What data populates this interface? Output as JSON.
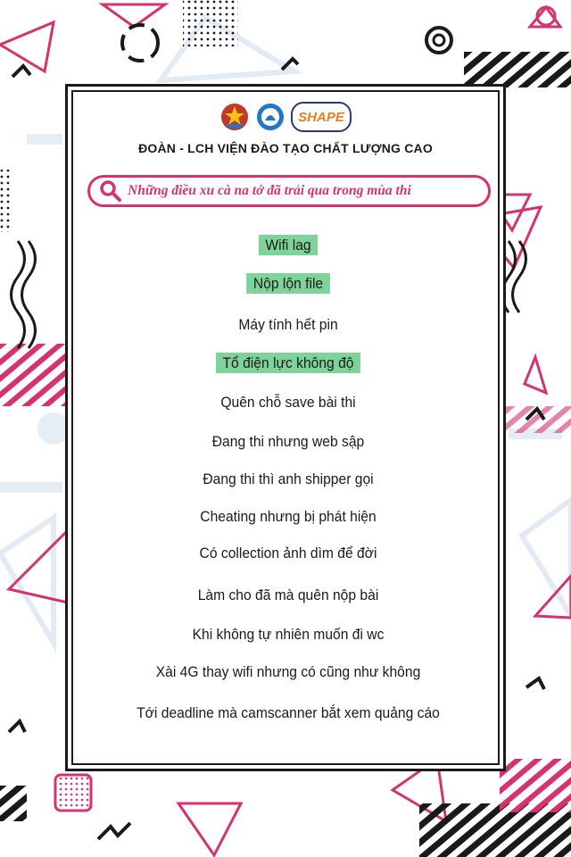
{
  "header": {
    "org_title": "ĐOÀN - LCH VIỆN ĐÀO TẠO CHẤT LƯỢNG CAO",
    "logos": [
      "youth-union-logo",
      "student-association-logo",
      "shape-logo"
    ],
    "shape_logo_text": "SHAPE"
  },
  "search": {
    "text": "Những điều xu cà na tớ đã trải qua trong mùa thi",
    "icon": "search-icon"
  },
  "items": [
    {
      "label": "Wifi lag",
      "highlighted": true
    },
    {
      "label": "Nộp lộn file",
      "highlighted": true
    },
    {
      "label": "Máy tính hết pin",
      "highlighted": false
    },
    {
      "label": "Tổ điện lực không độ",
      "highlighted": true
    },
    {
      "label": "Quên chỗ save bài thi",
      "highlighted": false
    },
    {
      "label": "Đang thi nhưng web sập",
      "highlighted": false
    },
    {
      "label": "Đang thi thì anh shipper gọi",
      "highlighted": false
    },
    {
      "label": "Cheating nhưng bị phát hiện",
      "highlighted": false
    },
    {
      "label": "Có collection ảnh dìm để đời",
      "highlighted": false
    },
    {
      "label": "Làm cho đã mà quên nộp bài",
      "highlighted": false
    },
    {
      "label": "Khi không tự nhiên muốn đi wc",
      "highlighted": false
    },
    {
      "label": "Xài 4G thay wifi nhưng  có cũng như không",
      "highlighted": false
    },
    {
      "label": "Tới deadline mà camscanner bắt xem quảng cáo",
      "highlighted": false
    }
  ],
  "colors": {
    "accent_pink": "#d6336c",
    "highlight_green": "#7ed39b",
    "text_dark": "#1a1a1a",
    "frame": "#1a1a1a",
    "faint_blue": "#dfe8f2"
  }
}
